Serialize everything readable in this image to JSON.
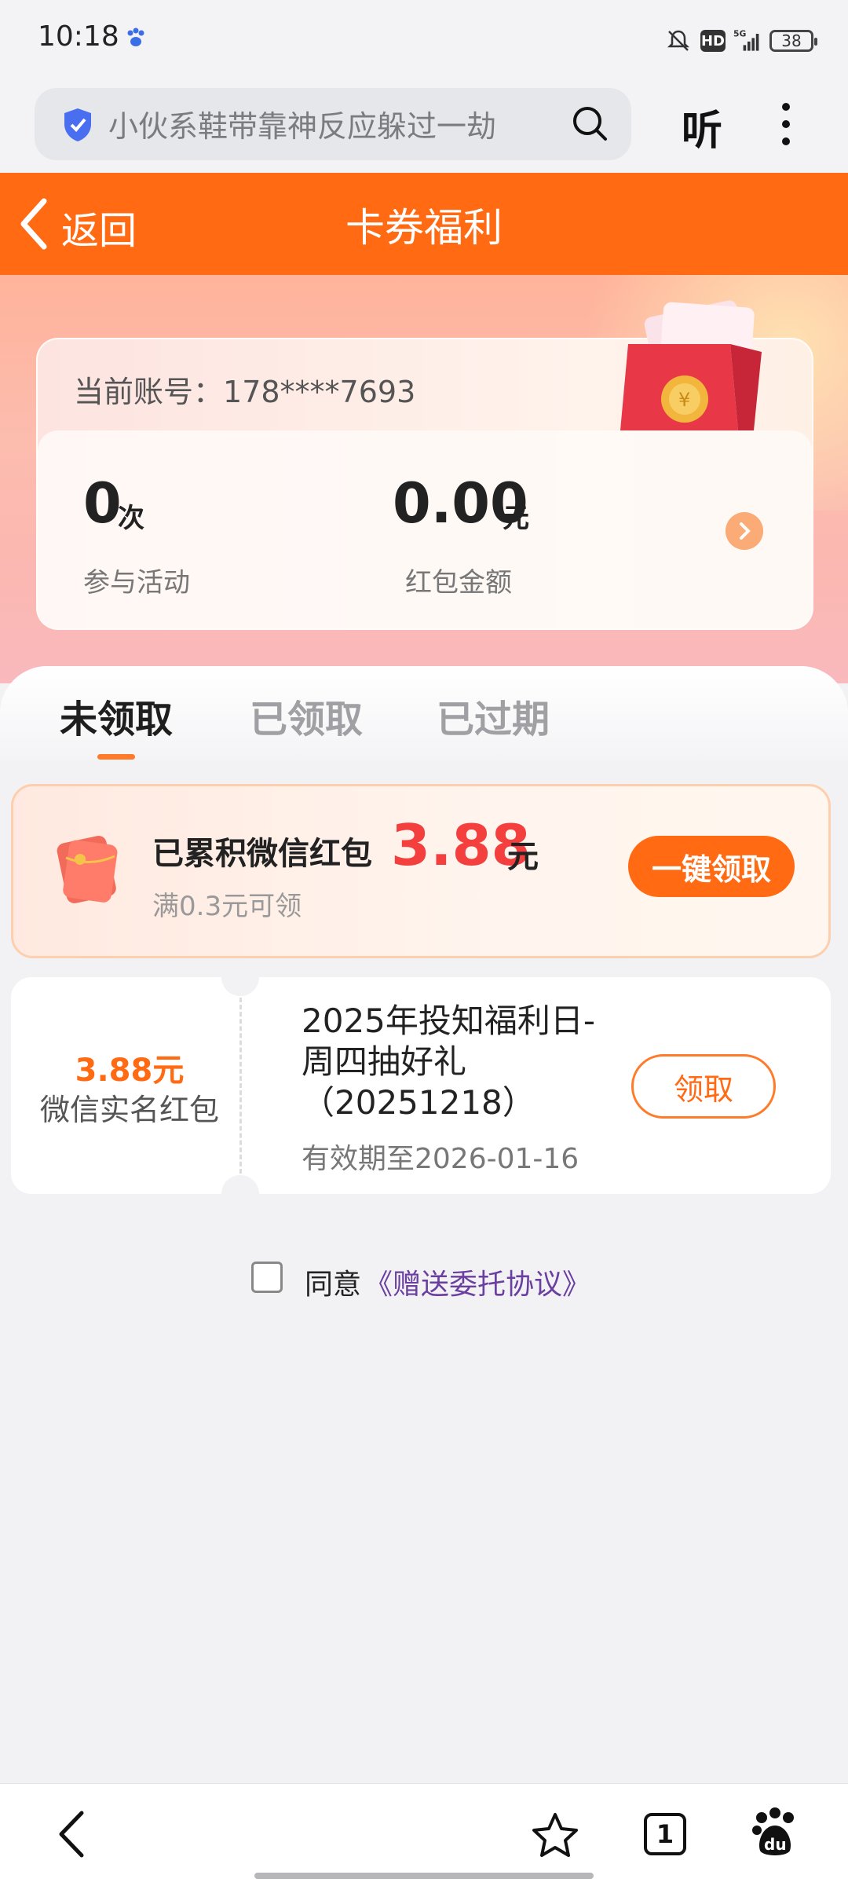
{
  "status_bar": {
    "time": "10:18",
    "hd": "HD",
    "network": "5G",
    "battery": "38"
  },
  "browser": {
    "search_text": "小伙系鞋带靠神反应躲过一劫",
    "listen_label": "听"
  },
  "header": {
    "back_label": "返回",
    "title": "卡券福利"
  },
  "account": {
    "label": "当前账号：",
    "number": "178****7693",
    "activities_count": "0",
    "activities_unit": "次",
    "activities_label": "参与活动",
    "amount": "0.00",
    "amount_unit": "元",
    "amount_label": "红包金额"
  },
  "tabs": [
    {
      "label": "未领取",
      "active": true
    },
    {
      "label": "已领取",
      "active": false
    },
    {
      "label": "已过期",
      "active": false
    }
  ],
  "accumulated": {
    "title": "已累积微信红包",
    "amount": "3.88",
    "unit": "元",
    "subtitle": "满0.3元可领",
    "button": "一键领取"
  },
  "coupon": {
    "amount": "3.88元",
    "type": "微信实名红包",
    "title": "2025年投知福利日-周四抽好礼（20251218）",
    "expiry": "有效期至2026-01-16",
    "button": "领取"
  },
  "agreement": {
    "prefix": "同意",
    "link": "《赠送委托协议》"
  },
  "bottom_nav": {
    "tab_count": "1"
  },
  "colors": {
    "accent": "#ff6a13",
    "amount_red": "#f43f3f",
    "link": "#6a3fa0"
  },
  "icons": [
    "paw-icon",
    "mute-icon",
    "signal-icon",
    "shield-icon",
    "search-icon",
    "more-icon",
    "back-arrow-icon",
    "chevron-right-icon",
    "red-packet-icon",
    "star-icon",
    "baidu-du-icon"
  ]
}
